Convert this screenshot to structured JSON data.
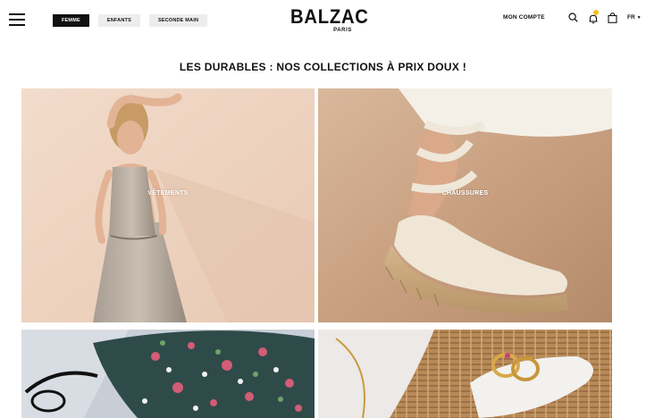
{
  "header": {
    "tabs": [
      {
        "label": "FEMME",
        "active": true
      },
      {
        "label": "ENFANTS",
        "active": false
      },
      {
        "label": "SECONDE MAIN",
        "active": false
      }
    ],
    "logo": {
      "main": "BALZAC",
      "sub": "PARIS"
    },
    "account_label": "MON COMPTE",
    "language": "FR",
    "notification_color": "#f2c318"
  },
  "headline": "LES DURABLES : NOS COLLECTIONS À PRIX DOUX !",
  "tiles": [
    {
      "label": "VÊTEMENTS"
    },
    {
      "label": "CHAUSSURES"
    },
    {
      "label": ""
    },
    {
      "label": ""
    }
  ]
}
